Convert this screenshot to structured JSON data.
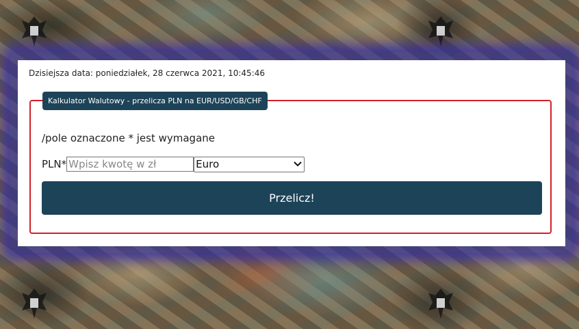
{
  "header": {
    "date_text": "Dzisiejsza data: poniedziałek, 28 czerwca 2021, 10:45:46"
  },
  "calculator": {
    "legend": "Kalkulator Walutowy - przelicza PLN na EUR/USD/GB/CHF",
    "required_note": "/pole oznaczone * jest wymagane",
    "amount_label": "PLN*",
    "amount_placeholder": "Wpisz kwotę w zł",
    "amount_value": "",
    "currency_selected": "Euro",
    "submit_label": "Przelicz!"
  },
  "colors": {
    "accent": "#1d4359",
    "border": "#d0202a",
    "glow": "#3228b4"
  },
  "icons": {
    "select_arrow": "chevron-down-icon",
    "background_emblem": "eagle-emblem-icon"
  }
}
